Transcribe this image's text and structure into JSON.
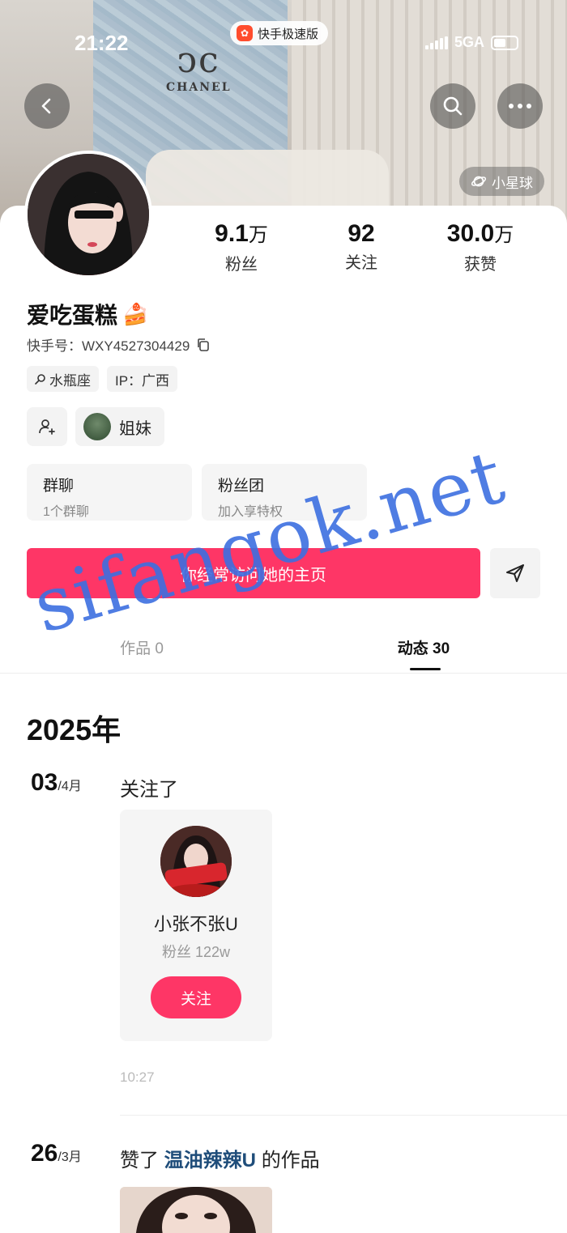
{
  "status_bar": {
    "time": "21:22",
    "app_name": "快手极速版",
    "network": "5GA"
  },
  "cover": {
    "brand_logo_text": "CHANEL",
    "planet_label": "小星球"
  },
  "profile": {
    "followers_num": "9.1",
    "followers_unit": "万",
    "followers_label": "粉丝",
    "following_num": "92",
    "following_label": "关注",
    "likes_num": "30.0",
    "likes_unit": "万",
    "likes_label": "获赞",
    "nickname": "爱吃蛋糕",
    "nickname_emoji": "🍰",
    "uid_text": "快手号：WXY4527304429",
    "tags": [
      {
        "icon": "search-icon",
        "label": "水瓶座"
      },
      {
        "label": "IP：广西"
      }
    ],
    "relation_label": "姐妹",
    "cards": [
      {
        "title": "群聊",
        "sub": "1个群聊"
      },
      {
        "title": "粉丝团",
        "sub": "加入享特权"
      }
    ],
    "visit_button": "你经常访问她的主页"
  },
  "tabs": [
    {
      "label": "作品 0"
    },
    {
      "label": "动态 30"
    }
  ],
  "timeline": {
    "year": "2025年",
    "entries": [
      {
        "day": "03",
        "month": "/4月",
        "action": "关注了",
        "card": {
          "name": "小张不张U",
          "fans": "粉丝 122w",
          "button": "关注"
        },
        "time": "10:27"
      },
      {
        "day": "26",
        "month": "/3月",
        "action_prefix": "赞了",
        "action_link": "温油辣辣U",
        "action_suffix": "的作品"
      }
    ]
  },
  "watermark": "sifangok.net",
  "colors": {
    "accent": "#fe3666",
    "link": "#1f4d7a",
    "watermark": "#3d6fe0"
  }
}
